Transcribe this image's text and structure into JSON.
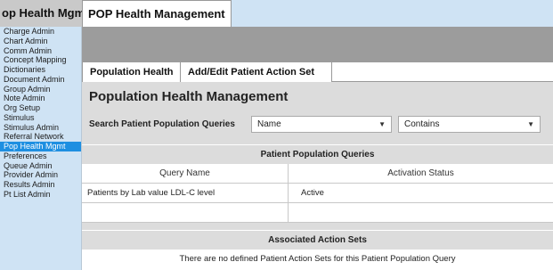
{
  "window": {
    "left_title": "op Health Mgmt",
    "app_tab": "POP Health Management"
  },
  "sidebar": {
    "items": [
      {
        "label": "Charge Admin"
      },
      {
        "label": "Chart Admin"
      },
      {
        "label": "Comm Admin"
      },
      {
        "label": "Concept Mapping"
      },
      {
        "label": "Dictionaries"
      },
      {
        "label": "Document Admin"
      },
      {
        "label": "Group Admin"
      },
      {
        "label": "Note Admin"
      },
      {
        "label": "Org Setup"
      },
      {
        "label": "Stimulus"
      },
      {
        "label": "Stimulus Admin"
      },
      {
        "label": "Referral Network"
      },
      {
        "label": "Pop Health Mgmt"
      },
      {
        "label": "Preferences"
      },
      {
        "label": "Queue Admin"
      },
      {
        "label": "Provider Admin"
      },
      {
        "label": "Results Admin"
      },
      {
        "label": "Pt List Admin"
      }
    ],
    "active_index": 12
  },
  "tabs": [
    {
      "label": "Population Health"
    },
    {
      "label": "Add/Edit Patient Action Set"
    }
  ],
  "main": {
    "title": "Population Health Management",
    "search_label": "Search Patient Population Queries",
    "field_select": "Name",
    "operator_select": "Contains"
  },
  "queries": {
    "heading": "Patient Population Queries",
    "columns": [
      "Query Name",
      "Activation Status"
    ],
    "rows": [
      {
        "name": "Patients by Lab value LDL-C level",
        "status": "Active"
      }
    ]
  },
  "action_sets": {
    "heading": "Associated Action Sets",
    "empty_message": "There are no defined Patient Action Sets for this Patient Population Query"
  },
  "colors": {
    "sidebar_bg": "#cfe3f4",
    "active_item": "#1e8fe1",
    "band": "#9c9c9c",
    "panel": "#dcdcdc"
  }
}
